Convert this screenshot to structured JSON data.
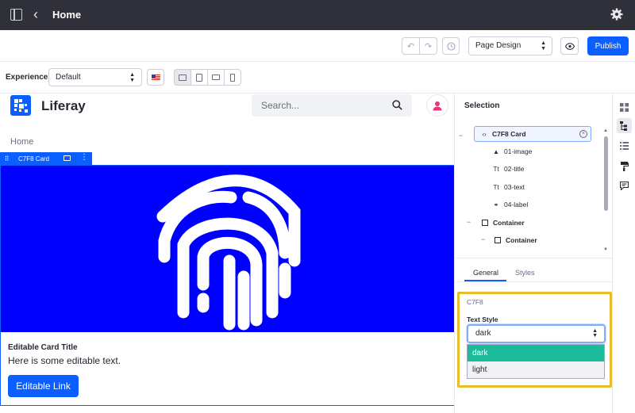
{
  "topbar": {
    "title": "Home"
  },
  "toolbar": {
    "mode_select": "Page Design",
    "publish_label": "Publish"
  },
  "experience": {
    "label": "Experience",
    "selected": "Default"
  },
  "site": {
    "name": "Liferay",
    "search_placeholder": "Search...",
    "breadcrumb": "Home"
  },
  "fragment": {
    "label": "C7F8 Card",
    "card_title": "Editable Card Title",
    "card_text": "Here is some editable text.",
    "card_link": "Editable Link",
    "image_color": "#0000ff"
  },
  "panel": {
    "title": "Selection",
    "tree": {
      "card": "C7F8 Card",
      "items": [
        "01-image",
        "02-title",
        "03-text",
        "04-label"
      ],
      "container": "Container",
      "inner_container": "Container"
    },
    "tabs": {
      "general": "General",
      "styles": "Styles"
    },
    "config": {
      "name": "C7F8",
      "text_style_label": "Text Style",
      "text_style_value": "dark",
      "options": [
        "dark",
        "light"
      ]
    }
  },
  "colors": {
    "accent": "#0b5fff",
    "highlight_border": "#e5bf2b",
    "selected_option": "#1bbc9b"
  }
}
